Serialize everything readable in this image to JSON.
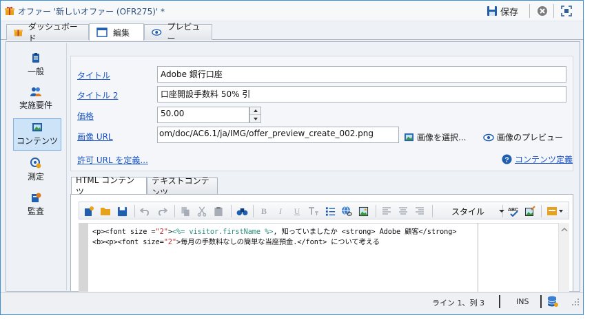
{
  "window": {
    "title": "オファー '新しいオファー (OFR275)' *",
    "save_label": "保存"
  },
  "top_tabs": [
    {
      "label": "ダッシュボード",
      "icon": "gift-icon"
    },
    {
      "label": "編集",
      "icon": "edit-window-icon",
      "active": true
    },
    {
      "label": "プレビュー",
      "icon": "eye-icon"
    }
  ],
  "sidenav": {
    "items": [
      {
        "label": "一般",
        "icon": "clipboard-icon"
      },
      {
        "label": "実施要件",
        "icon": "users-icon"
      },
      {
        "label": "コンテンツ",
        "icon": "image-icon",
        "active": true
      },
      {
        "label": "測定",
        "icon": "target-icon"
      },
      {
        "label": "監査",
        "icon": "audit-icon"
      }
    ]
  },
  "form": {
    "title_label": "タイトル",
    "title_value": "Adobe 銀行口座",
    "title2_label": "タイトル 2",
    "title2_value": "口座開設手数料 50% 引",
    "price_label": "価格",
    "price_value": "50.00",
    "image_url_label": "画像 URL",
    "image_url_value": "om/doc/AC6.1/ja/IMG/offer_preview_create_002.png",
    "select_image_label": "画像を選択...",
    "preview_image_label": "画像のプレビュー",
    "allowed_url_label": "許可 URL を定義...",
    "content_def_label": "コンテンツ定義"
  },
  "content_tabs": [
    {
      "label": "HTML コンテンツ",
      "active": true
    },
    {
      "label": "テキストコンテンツ"
    }
  ],
  "editor": {
    "style_label": "スタイル",
    "code": {
      "line1_open": "<p><font size =",
      "line1_size": "\"2\"",
      "line1_gt": ">",
      "line1_var": "<%= visitor.firstName %>",
      "line1_rest": ", 知っていましたか <strong> Adobe 顧客</strong>",
      "line2_open": "<b><p><font size=",
      "line2_size": "\"2\"",
      "line2_rest": ">毎月の手数料なしの簡単な当座預金.</font> について考える"
    }
  },
  "status": {
    "position": "ライン 1、列 3",
    "mode": "INS"
  },
  "colors": {
    "accent": "#3c8fd4",
    "link": "#1b55c6",
    "nav_active_bg": "#cde3f7"
  }
}
